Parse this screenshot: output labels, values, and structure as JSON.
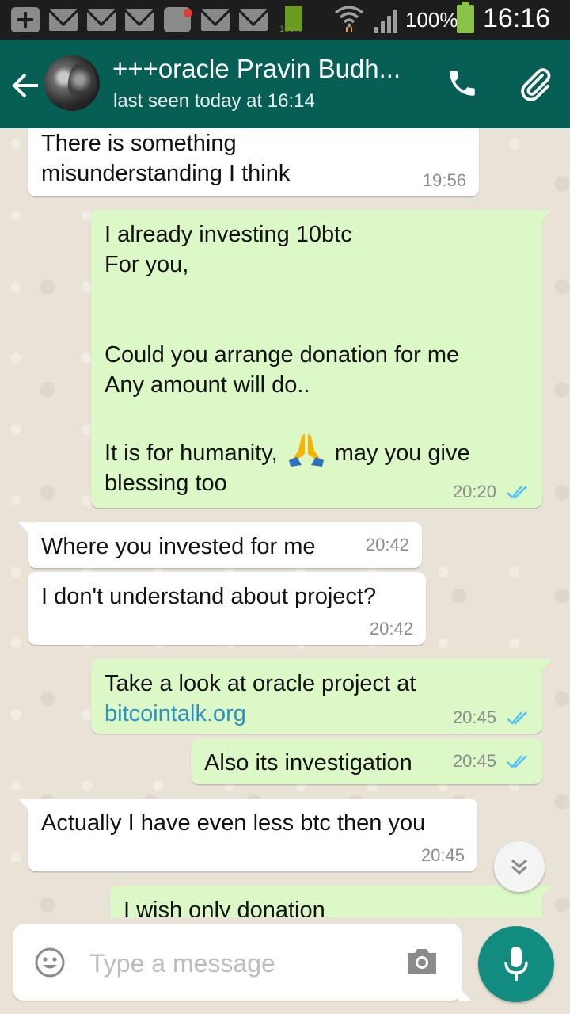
{
  "status_bar": {
    "battery_small_label": "100%",
    "battery_percent": "100%",
    "time": "16:16"
  },
  "header": {
    "contact_name": "+++oracle Pravin Budh...",
    "last_seen": "last seen today at 16:14"
  },
  "messages": [
    {
      "direction": "in",
      "text": "There is something\nmisunderstanding I think",
      "time": "19:56"
    },
    {
      "direction": "out",
      "text_before_emoji": "I already investing 10btc\nFor you,\n\n\nCould you arrange donation for me\nAny amount will do..\n\nIt is for humanity, ",
      "text_after_emoji": " may you give blessing too",
      "emoji": "folded-hands",
      "time": "20:20",
      "status": "read"
    },
    {
      "direction": "in",
      "text": "Where you invested for me",
      "time": "20:42"
    },
    {
      "direction": "in",
      "text": "I don't understand about project?",
      "time": "20:42"
    },
    {
      "direction": "out",
      "text": "Take a look at oracle project at",
      "link": "bitcointalk.org",
      "time": "20:45",
      "status": "read"
    },
    {
      "direction": "out",
      "text": "Also its investigation",
      "time": "20:45",
      "status": "read"
    },
    {
      "direction": "in",
      "text": "Actually I have even less btc then you",
      "time": "20:45"
    },
    {
      "direction": "out",
      "text": "I wish only donation",
      "time": "",
      "status": ""
    }
  ],
  "composer": {
    "placeholder": "Type a message"
  },
  "colors": {
    "header": "#075e54",
    "outgoing_bubble": "#dcf8c6",
    "incoming_bubble": "#ffffff",
    "read_ticks": "#4fc3f7",
    "mic_button": "#128c7e"
  },
  "icons": [
    "back-arrow-icon",
    "call-icon",
    "attach-icon",
    "emoji-icon",
    "camera-icon",
    "mic-icon",
    "chevron-double-down-icon"
  ]
}
